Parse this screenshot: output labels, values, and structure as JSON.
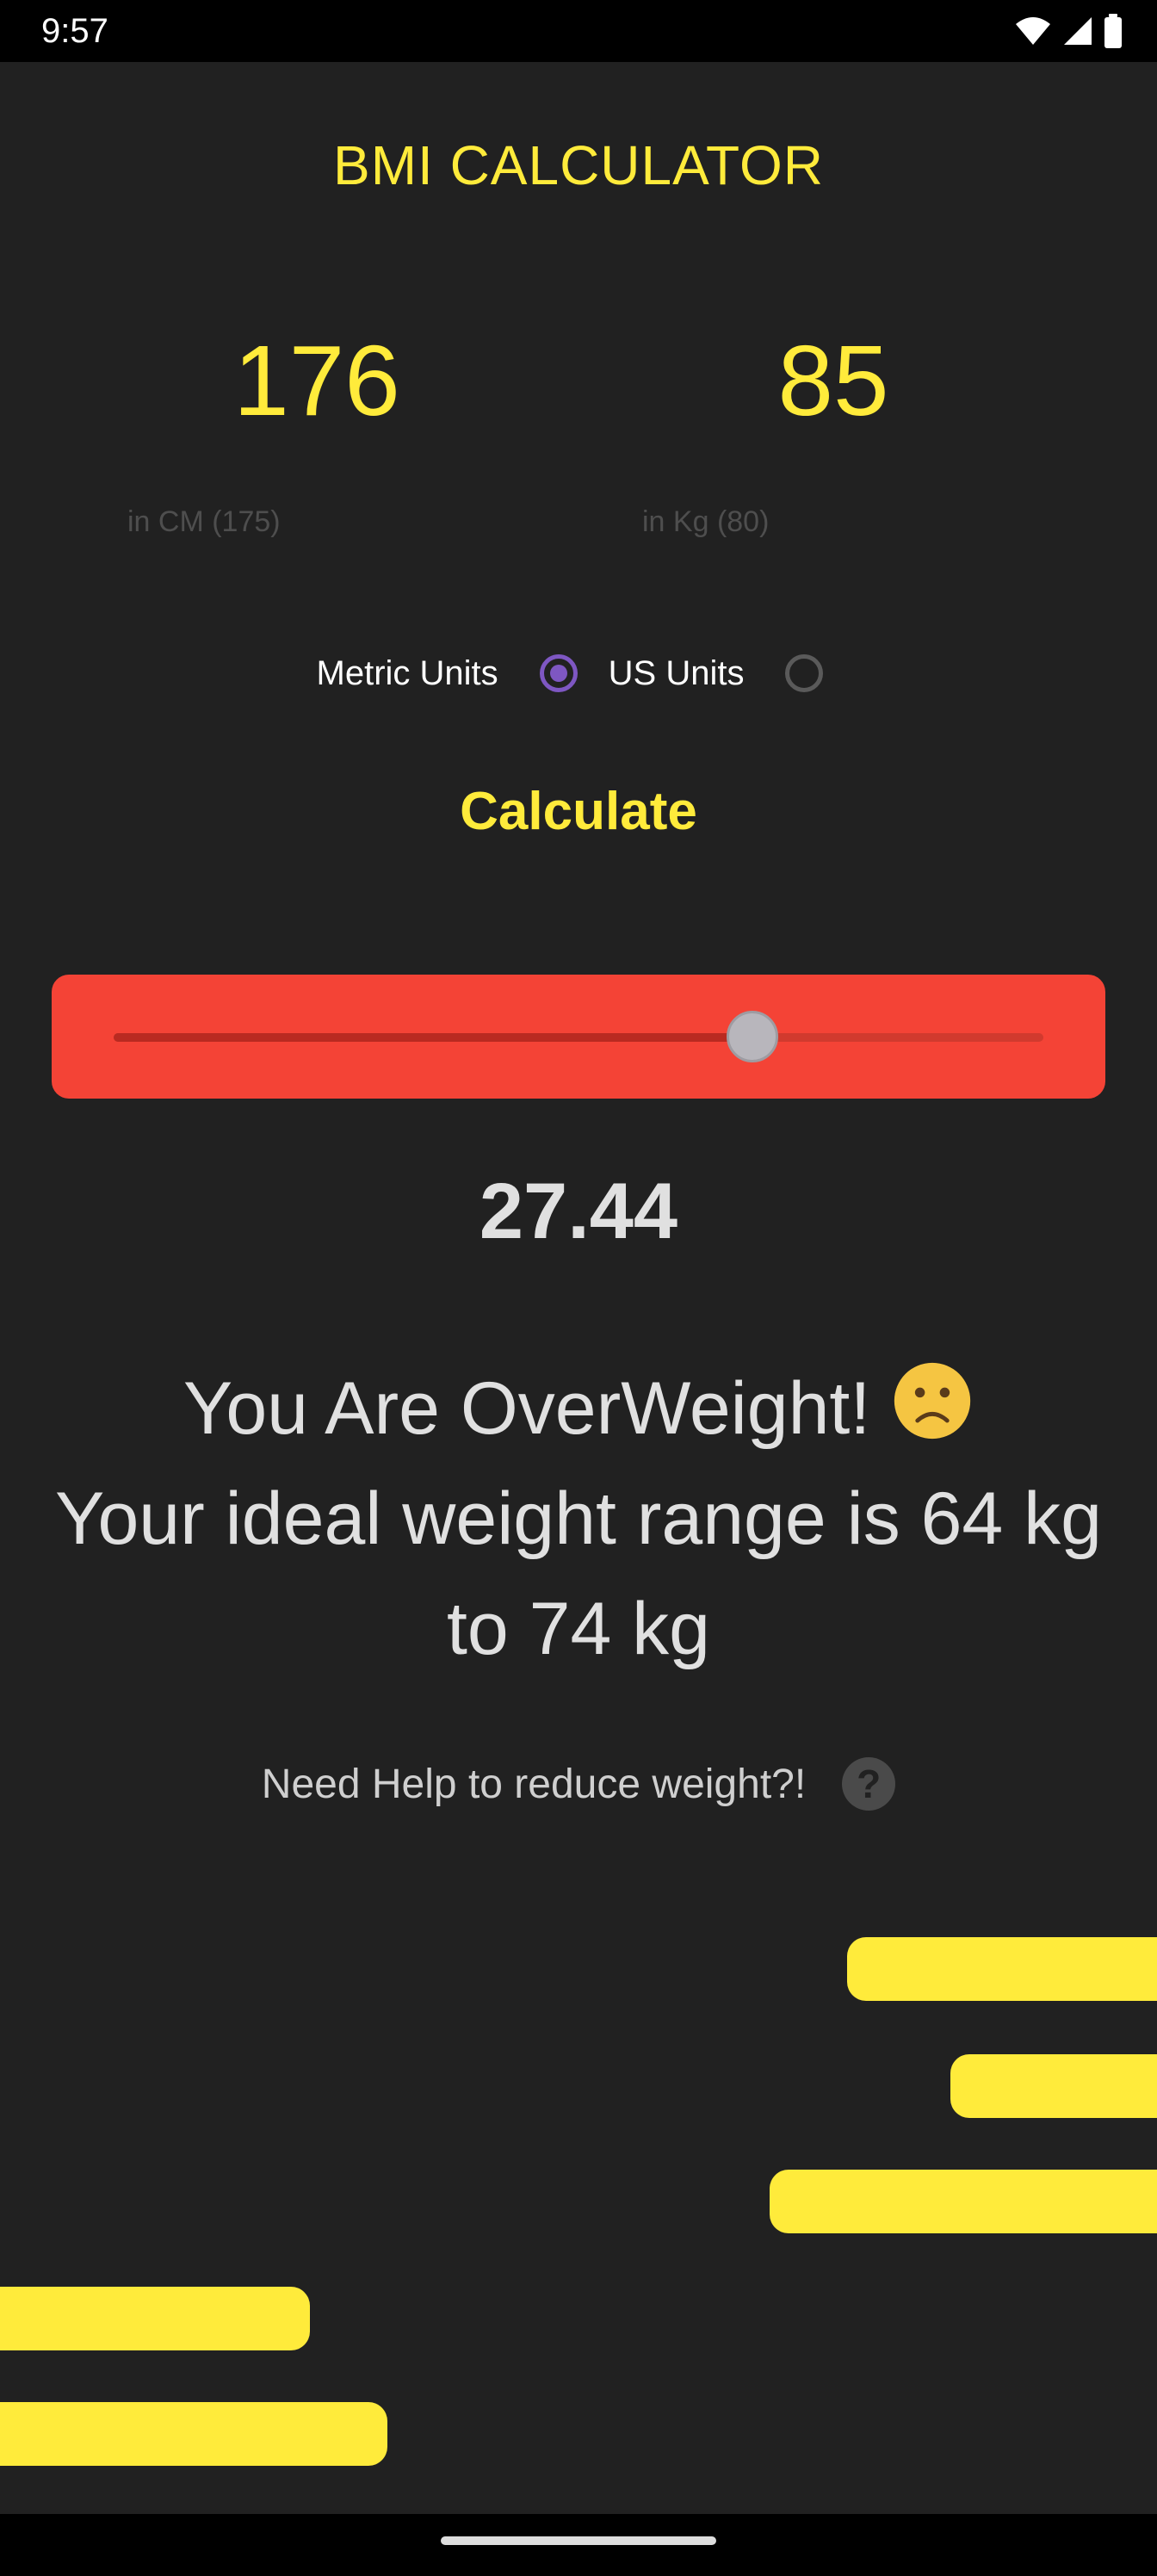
{
  "status_bar": {
    "time": "9:57",
    "icons": [
      "wifi-icon",
      "cellular-signal-icon",
      "battery-icon"
    ]
  },
  "app": {
    "title": "BMI CALCULATOR",
    "height": {
      "value": "176",
      "hint": "in CM (175)"
    },
    "weight": {
      "value": "85",
      "hint": "in Kg (80)"
    },
    "units": {
      "metric_label": "Metric Units",
      "us_label": "US Units",
      "selected": "metric"
    },
    "calculate_label": "Calculate",
    "bmi_slider": {
      "fraction": 0.687,
      "color": "#f44336"
    },
    "bmi_value": "27.44",
    "result": {
      "status_text": "You Are OverWeight!",
      "status_icon": "sad-face-emoji-icon",
      "ideal_line_1": "Your ideal weight range is 64 kg",
      "ideal_line_2": "to 74 kg"
    },
    "help_text": "Need Help to reduce weight?!",
    "help_icon": "question-mark-icon"
  },
  "colors": {
    "background": "#212121",
    "accent": "#ffeb3b",
    "slider_box": "#f44336",
    "radio_checked": "#7e57c2"
  }
}
